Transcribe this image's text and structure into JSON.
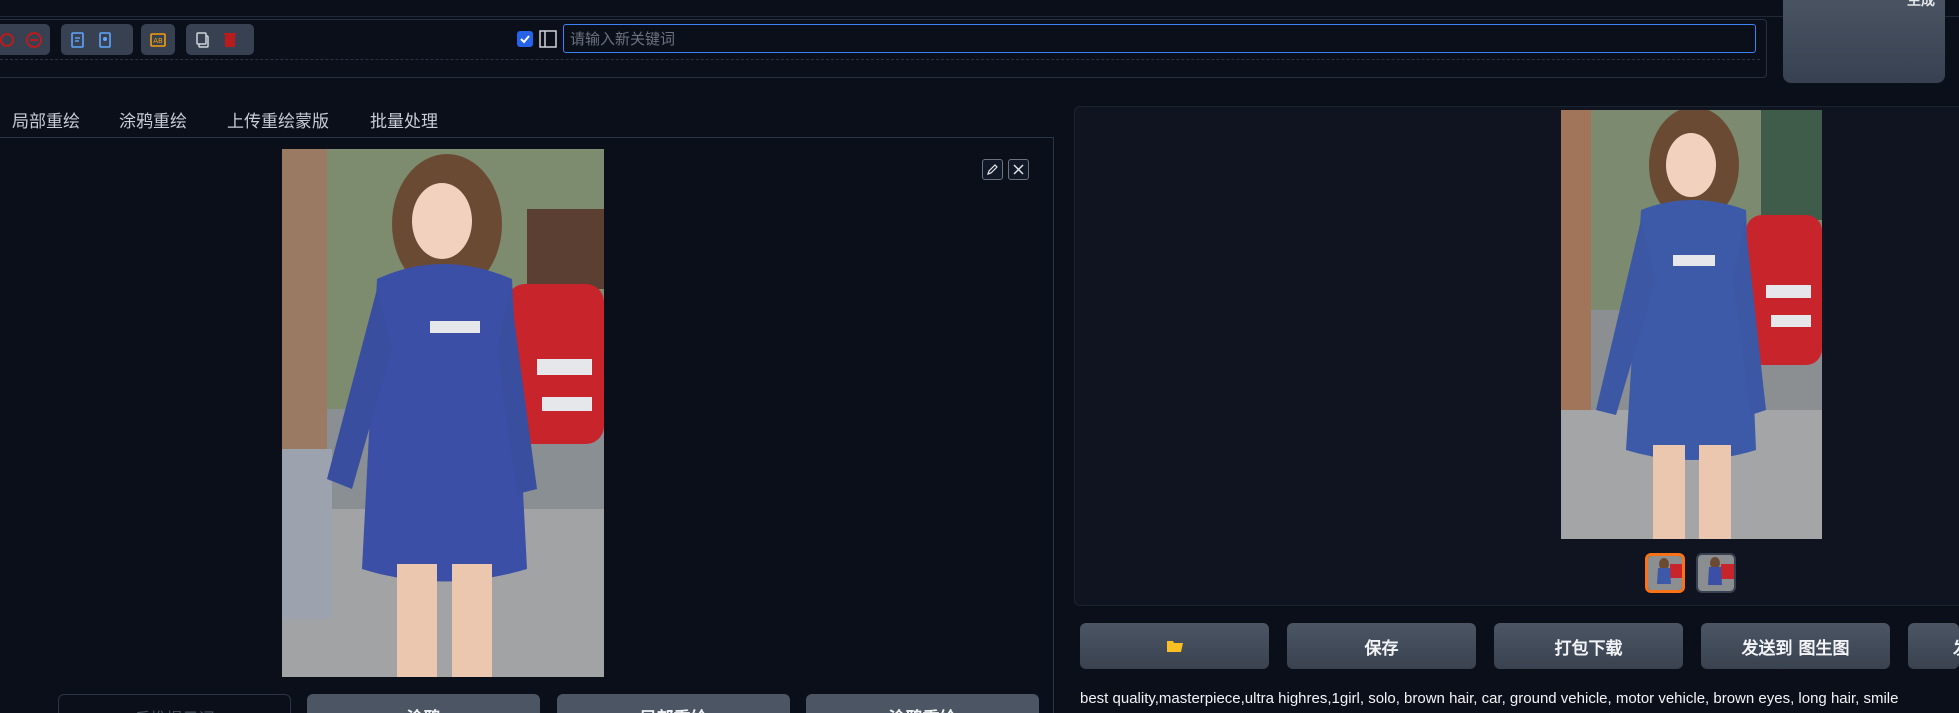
{
  "toolbar": {
    "keyword_placeholder": "请输入新关键词",
    "generate_label": "生成"
  },
  "tabs": [
    {
      "label": "局部重绘"
    },
    {
      "label": "涂鸦重绘"
    },
    {
      "label": "上传重绘蒙版"
    },
    {
      "label": "批量处理"
    }
  ],
  "left_panel": {
    "bottom_buttons": [
      {
        "label": "反推提示词"
      },
      {
        "label": "涂鸦"
      },
      {
        "label": "局部重绘"
      },
      {
        "label": "涂鸦重绘"
      }
    ]
  },
  "right_panel": {
    "actions": [
      {
        "label": "",
        "icon": "folder-icon"
      },
      {
        "label": "保存"
      },
      {
        "label": "打包下载"
      },
      {
        "label": "发送到 图生图"
      },
      {
        "label": "发"
      }
    ],
    "prompt": "best quality,masterpiece,ultra highres,1girl, solo, brown hair, car, ground vehicle, motor vehicle, brown eyes, long hair, smile"
  },
  "colors": {
    "background": "#0b0f19",
    "accent": "#3b82f6",
    "selected_thumb": "#f97316",
    "button": "#4b5563"
  }
}
